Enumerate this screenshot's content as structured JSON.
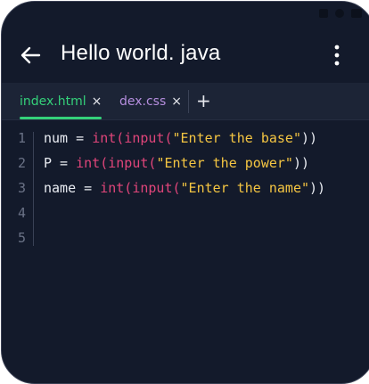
{
  "header": {
    "title": "Hello world. java",
    "back_icon": "arrow-left-icon",
    "menu_icon": "more-vertical-icon"
  },
  "tabs": [
    {
      "label": "index.html",
      "active": true
    },
    {
      "label": "dex.css",
      "active": false
    }
  ],
  "tab_close_glyph": "×",
  "tab_add_glyph": "+",
  "editor": {
    "lines": [
      {
        "number": "1",
        "tokens": [
          {
            "text": "num = ",
            "kind": "plain"
          },
          {
            "text": "int(input(",
            "kind": "fn"
          },
          {
            "text": "\"Enter the base\"",
            "kind": "str"
          },
          {
            "text": "))",
            "kind": "plain"
          }
        ]
      },
      {
        "number": "2",
        "tokens": [
          {
            "text": "P = ",
            "kind": "plain"
          },
          {
            "text": "int(input(",
            "kind": "fn"
          },
          {
            "text": "\"Enter the power\"",
            "kind": "str"
          },
          {
            "text": "))",
            "kind": "plain"
          }
        ]
      },
      {
        "number": "3",
        "tokens": [
          {
            "text": "name = ",
            "kind": "plain"
          },
          {
            "text": "int(input(",
            "kind": "fn"
          },
          {
            "text": "\"Enter the name\"",
            "kind": "str"
          },
          {
            "text": "))",
            "kind": "plain"
          }
        ]
      },
      {
        "number": "4",
        "tokens": []
      },
      {
        "number": "5",
        "tokens": []
      }
    ]
  },
  "colors": {
    "background": "#131a2b",
    "tabbar": "#1c2436",
    "active_tab": "#34d17a",
    "inactive_tab": "#b58ede",
    "keyword": "#e0457a",
    "string": "#f4c542",
    "text": "#e9ecf2"
  }
}
